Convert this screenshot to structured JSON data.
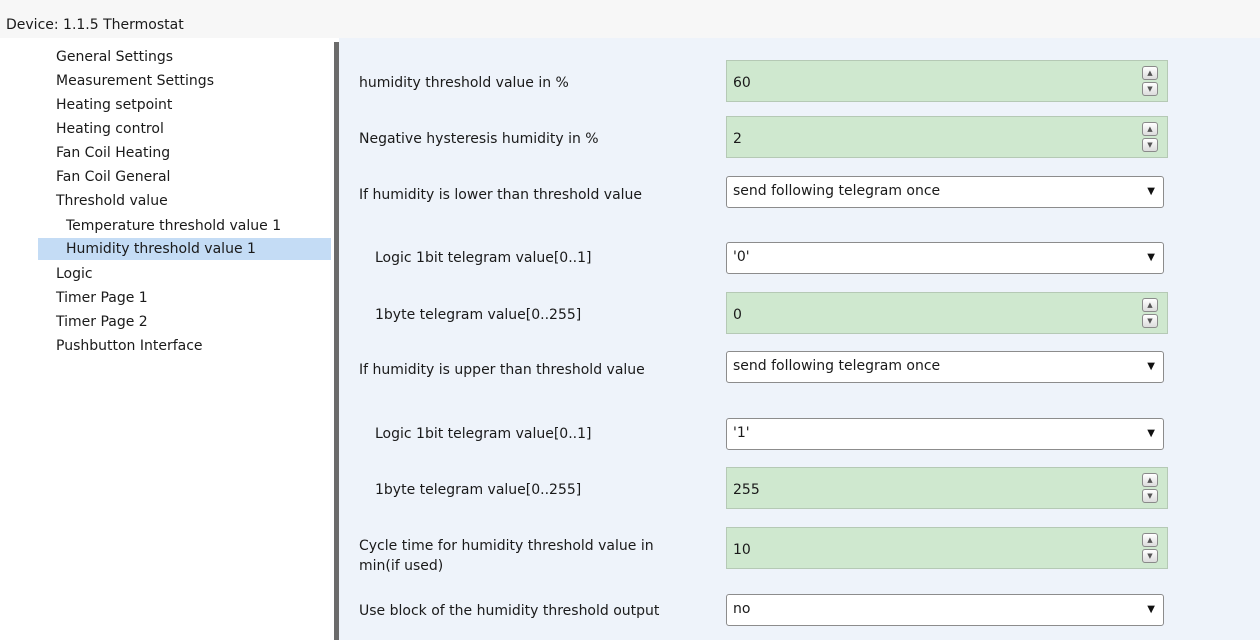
{
  "window": {
    "title": "Device: 1.1.5  Thermostat"
  },
  "sidebar": {
    "items": [
      "General Settings",
      "Measurement Settings",
      "Heating setpoint",
      "Heating control",
      "Fan Coil Heating",
      "Fan Coil General",
      "Threshold value",
      "Temperature threshold value 1",
      "Humidity threshold value 1",
      "Logic",
      "Timer Page 1",
      "Timer Page 2",
      "Pushbutton Interface"
    ],
    "selected": "Humidity threshold value 1"
  },
  "params": {
    "humidity_threshold": {
      "label": "humidity threshold value in %",
      "value": "60"
    },
    "neg_hysteresis": {
      "label": "Negative hysteresis humidity in %",
      "value": "2"
    },
    "if_lower": {
      "label": "If humidity is lower than threshold value",
      "value": "send following telegram once"
    },
    "lower_1bit": {
      "label": "Logic 1bit telegram value[0..1]",
      "value": "'0'"
    },
    "lower_1byte": {
      "label": "1byte telegram value[0..255]",
      "value": "0"
    },
    "if_upper": {
      "label": "If humidity is upper than threshold value",
      "value": "send following telegram once"
    },
    "upper_1bit": {
      "label": "Logic 1bit telegram value[0..1]",
      "value": "'1'"
    },
    "upper_1byte": {
      "label": "1byte telegram value[0..255]",
      "value": "255"
    },
    "cycle_time": {
      "label": "Cycle time for humidity threshold value in min(if used)",
      "value": "10"
    },
    "use_block": {
      "label": "Use block of the humidity threshold output",
      "value": "no"
    }
  },
  "colors": {
    "spin_bg": "#cfe8cf",
    "selected_bg": "#c4dcf5",
    "panel_bg": "#eef3fa"
  }
}
